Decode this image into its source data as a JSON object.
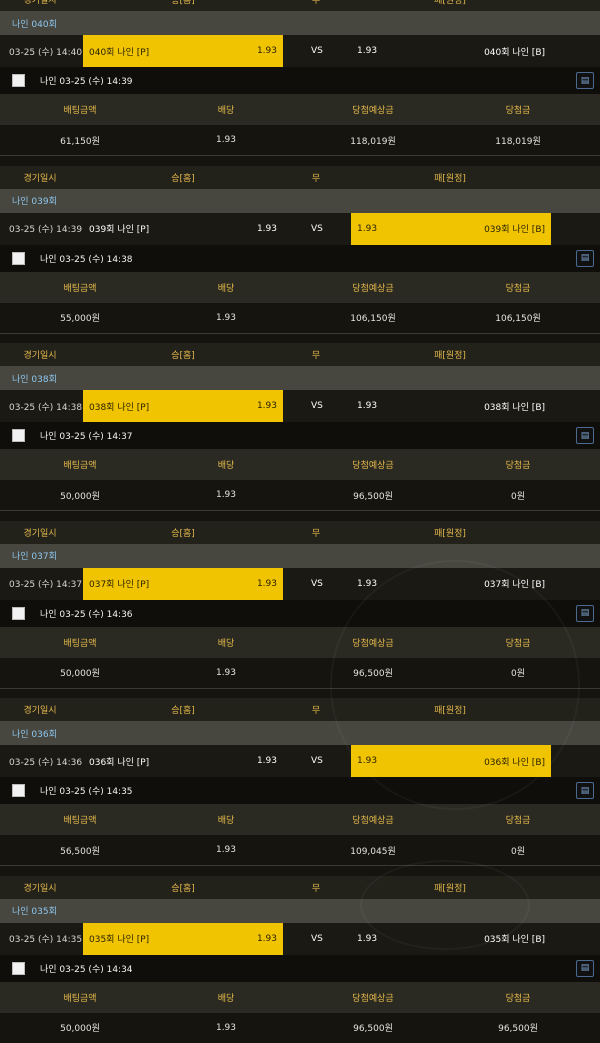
{
  "header_labels": {
    "date": "경기일시",
    "home": "승[홈]",
    "draw": "무",
    "away": "패[원정]"
  },
  "detail_labels": {
    "bet_amount": "배팅금액",
    "odds": "배당",
    "expected": "당첨예상금",
    "won": "당첨금"
  },
  "vs_label": "VS",
  "doc_icon": "document-icon",
  "colors": {
    "selected": "#f0c400",
    "title_bar": "#474740",
    "title_text": "#8ec6ee",
    "header_text": "#e3b84a"
  },
  "bets": [
    {
      "round": "나인 040회",
      "date": "03-25 (수) 14:40",
      "home_name": "040회 나인 [P]",
      "home_odds": "1.93",
      "away_odds": "1.93",
      "away_name": "040회 나인 [B]",
      "selected": "home",
      "bet_line": "나인   03-25 (수) 14:39",
      "amount": "61,150원",
      "odds": "1.93",
      "expected": "118,019원",
      "won": "118,019원"
    },
    {
      "round": "나인 039회",
      "date": "03-25 (수) 14:39",
      "home_name": "039회 나인 [P]",
      "home_odds": "1.93",
      "away_odds": "1.93",
      "away_name": "039회 나인 [B]",
      "selected": "away",
      "bet_line": "나인   03-25 (수) 14:38",
      "amount": "55,000원",
      "odds": "1.93",
      "expected": "106,150원",
      "won": "106,150원"
    },
    {
      "round": "나인 038회",
      "date": "03-25 (수) 14:38",
      "home_name": "038회 나인 [P]",
      "home_odds": "1.93",
      "away_odds": "1.93",
      "away_name": "038회 나인 [B]",
      "selected": "home",
      "bet_line": "나인   03-25 (수) 14:37",
      "amount": "50,000원",
      "odds": "1.93",
      "expected": "96,500원",
      "won": "0원"
    },
    {
      "round": "나인 037회",
      "date": "03-25 (수) 14:37",
      "home_name": "037회 나인 [P]",
      "home_odds": "1.93",
      "away_odds": "1.93",
      "away_name": "037회 나인 [B]",
      "selected": "home",
      "bet_line": "나인   03-25 (수) 14:36",
      "amount": "50,000원",
      "odds": "1.93",
      "expected": "96,500원",
      "won": "0원"
    },
    {
      "round": "나인 036회",
      "date": "03-25 (수) 14:36",
      "home_name": "036회 나인 [P]",
      "home_odds": "1.93",
      "away_odds": "1.93",
      "away_name": "036회 나인 [B]",
      "selected": "away",
      "bet_line": "나인   03-25 (수) 14:35",
      "amount": "56,500원",
      "odds": "1.93",
      "expected": "109,045원",
      "won": "0원"
    },
    {
      "round": "나인 035회",
      "date": "03-25 (수) 14:35",
      "home_name": "035회 나인 [P]",
      "home_odds": "1.93",
      "away_odds": "1.93",
      "away_name": "035회 나인 [B]",
      "selected": "home",
      "bet_line": "나인   03-25 (수) 14:34",
      "amount": "50,000원",
      "odds": "1.93",
      "expected": "96,500원",
      "won": "96,500원"
    }
  ]
}
